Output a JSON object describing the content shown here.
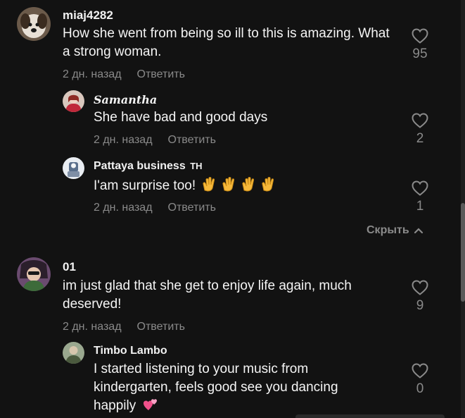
{
  "comments": [
    {
      "username": "miaj4282",
      "text": "How she went from being so ill to this is amazing. What a strong woman.",
      "time": "2 дн. назад",
      "reply": "Ответить",
      "likes": "95"
    },
    {
      "username": "𝑺𝒂𝒎𝒂𝒏𝒕𝒉𝒂",
      "text": "She have bad and good days",
      "time": "2 дн. назад",
      "reply": "Ответить",
      "likes": "2"
    },
    {
      "username": "Pattaya business",
      "username_suffix": "TH",
      "text": "I'am surprise too!",
      "emoji": "clapping-hands x4",
      "time": "2 дн. назад",
      "reply": "Ответить",
      "likes": "1"
    },
    {
      "username": "01",
      "text": "im just glad that she get to enjoy life again, much deserved!",
      "time": "2 дн. назад",
      "reply": "Ответить",
      "likes": "9"
    },
    {
      "username": "Timbo Lambo",
      "text_lines": [
        "I started listening to your music from",
        "kindergarten, feels good see you dancing",
        "happily"
      ],
      "emoji": "two-hearts",
      "likes": "0"
    }
  ],
  "collapse_label": "Скрыть",
  "colors": {
    "background": "#121212",
    "secondary_text": "#8a8a8a",
    "primary_text": "#f5f5f5"
  },
  "icons": [
    "heart-outline-icon",
    "chevron-up-icon",
    "clapping-hands-emoji",
    "two-hearts-emoji"
  ]
}
